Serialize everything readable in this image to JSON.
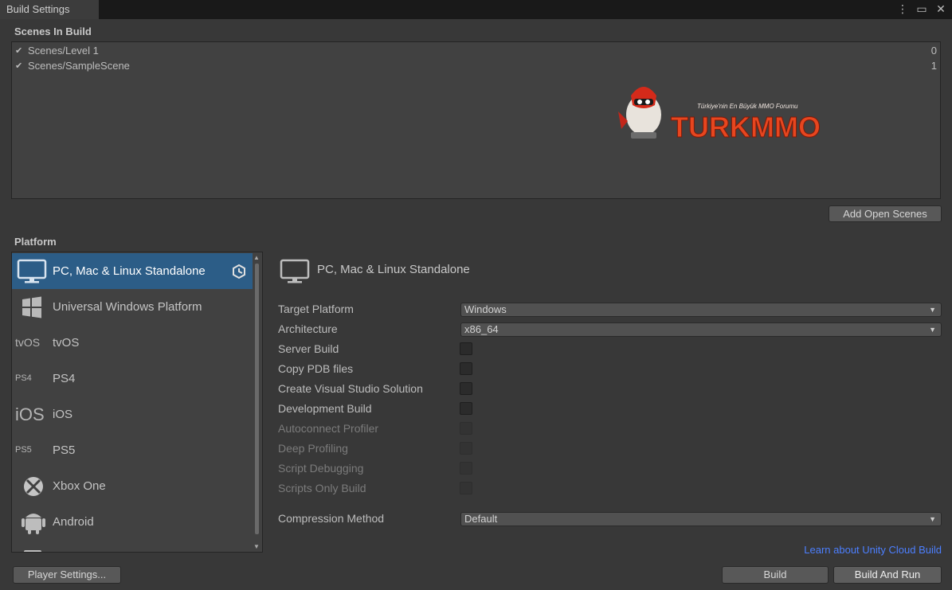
{
  "window": {
    "tab_title": "Build Settings",
    "controls": [
      "more-icon",
      "maximize-icon",
      "close-icon"
    ]
  },
  "scenes": {
    "heading": "Scenes In Build",
    "items": [
      {
        "name": "Scenes/Level 1",
        "index": "0",
        "checked": true
      },
      {
        "name": "Scenes/SampleScene",
        "index": "1",
        "checked": true
      }
    ],
    "add_open_scenes_label": "Add Open Scenes"
  },
  "watermark": {
    "logo_text": "TURKMMO",
    "tagline": "Türkiye'nin En Büyük MMO Forumu"
  },
  "platform": {
    "heading": "Platform",
    "items": [
      {
        "label": "PC, Mac & Linux Standalone",
        "icon": "monitor-icon",
        "selected": true
      },
      {
        "label": "Universal Windows Platform",
        "icon": "windows-icon",
        "selected": false
      },
      {
        "label": "tvOS",
        "icon": "tvos-icon",
        "icon_text": "tvOS",
        "selected": false
      },
      {
        "label": "PS4",
        "icon": "ps4-icon",
        "icon_text": "PS4",
        "selected": false
      },
      {
        "label": "iOS",
        "icon": "ios-icon",
        "icon_text": "iOS",
        "selected": false
      },
      {
        "label": "PS5",
        "icon": "ps5-icon",
        "icon_text": "PS5",
        "selected": false
      },
      {
        "label": "Xbox One",
        "icon": "xbox-icon",
        "selected": false
      },
      {
        "label": "Android",
        "icon": "android-icon",
        "selected": false
      }
    ]
  },
  "detail": {
    "title": "PC, Mac & Linux Standalone",
    "settings": {
      "target_platform": {
        "label": "Target Platform",
        "value": "Windows"
      },
      "architecture": {
        "label": "Architecture",
        "value": "x86_64"
      },
      "server_build": {
        "label": "Server Build"
      },
      "copy_pdb": {
        "label": "Copy PDB files"
      },
      "create_vs": {
        "label": "Create Visual Studio Solution"
      },
      "development_build": {
        "label": "Development Build"
      },
      "autoconnect_profiler": {
        "label": "Autoconnect Profiler"
      },
      "deep_profiling": {
        "label": "Deep Profiling"
      },
      "script_debugging": {
        "label": "Script Debugging"
      },
      "scripts_only": {
        "label": "Scripts Only Build"
      },
      "compression": {
        "label": "Compression Method",
        "value": "Default"
      }
    },
    "cloud_link": "Learn about Unity Cloud Build"
  },
  "footer": {
    "player_settings": "Player Settings...",
    "build": "Build",
    "build_and_run": "Build And Run"
  },
  "colors": {
    "background": "#383838",
    "selection": "#2c5d87",
    "link": "#4c7fff"
  }
}
